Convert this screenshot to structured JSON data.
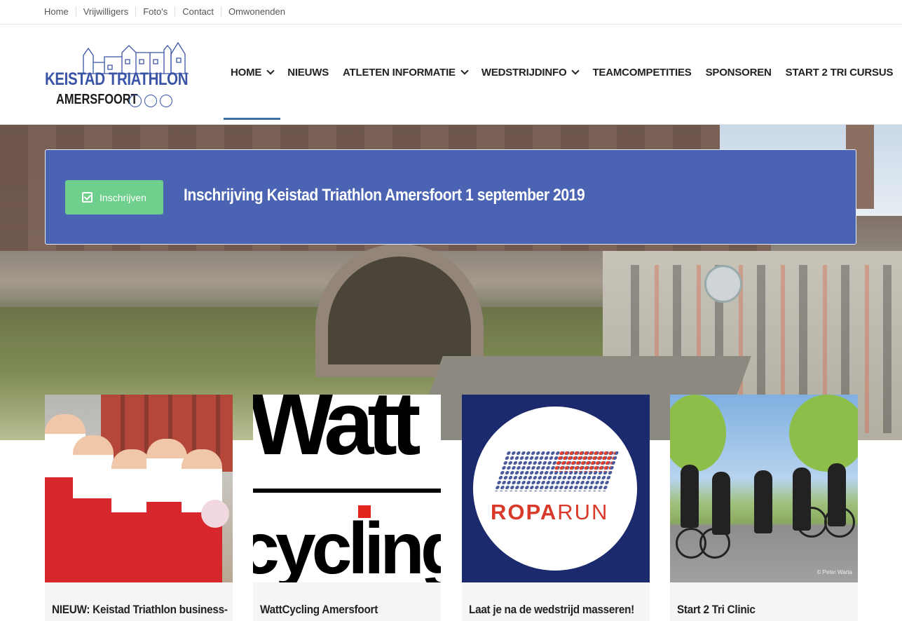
{
  "topnav": {
    "items": [
      "Home",
      "Vrijwilligers",
      "Foto's",
      "Contact",
      "Omwonenden"
    ]
  },
  "logo": {
    "line1": "KEISTAD TRIATHLON",
    "line2": "AMERSFOORT"
  },
  "mainnav": {
    "items": [
      {
        "label": "HOME",
        "dropdown": true,
        "active": true
      },
      {
        "label": "NIEUWS",
        "dropdown": false
      },
      {
        "label": "ATLETEN INFORMATIE",
        "dropdown": true
      },
      {
        "label": "WEDSTRIJDINFO",
        "dropdown": true
      },
      {
        "label": "TEAMCOMPETITIES",
        "dropdown": false
      },
      {
        "label": "SPONSOREN",
        "dropdown": false
      },
      {
        "label": "START 2 TRI CURSUS",
        "dropdown": false
      }
    ]
  },
  "banner": {
    "button_label": "Inschrijven",
    "headline": "Inschrijving Keistad Triathlon Amersfoort 1 september 2019",
    "background_color": "#4a63b2",
    "button_color": "#6fcf8c"
  },
  "cards": [
    {
      "title": "NIEUW: Keistad Triathlon business-"
    },
    {
      "title": "WattCycling Amersfoort",
      "logo_top": "Watt",
      "logo_bottom": "cycling"
    },
    {
      "title": "Laat je na de wedstrijd masseren!",
      "logo_a": "ROPA",
      "logo_b": "RUN"
    },
    {
      "title": "Start 2 Tri Clinic",
      "photo_credit": "© Peter Warta"
    }
  ]
}
